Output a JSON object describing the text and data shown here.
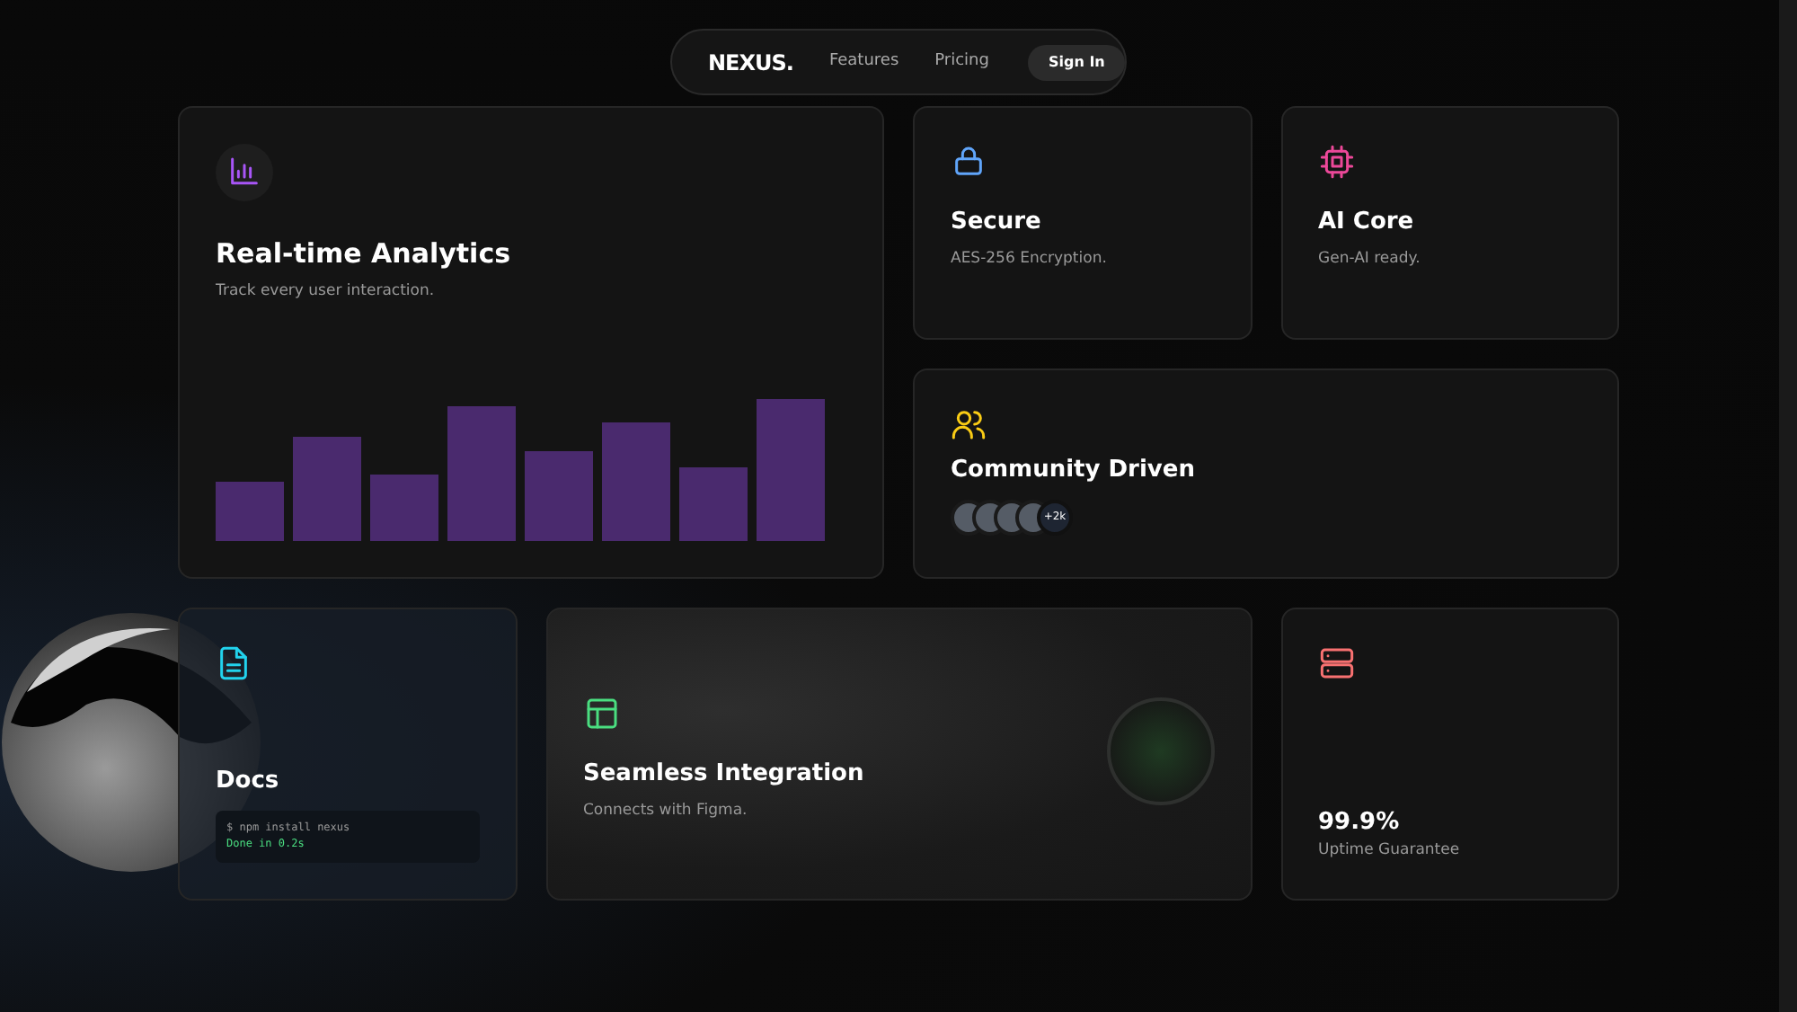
{
  "nav": {
    "logo": "NEXUS.",
    "links": [
      "Features",
      "Pricing"
    ],
    "button": "Sign In"
  },
  "cards": [
    {
      "kind": "analytics",
      "title": "Real-time Analytics",
      "text": "Track every user interaction.",
      "color": "#a855f7"
    },
    {
      "kind": "secure",
      "title": "Secure",
      "text": "AES-256 Encryption.",
      "color": "#60a5fa"
    },
    {
      "kind": "ai",
      "title": "AI Core",
      "text": "Gen-AI ready.",
      "color": "#ec4899"
    },
    {
      "kind": "community",
      "title": "Community Driven",
      "avatars": [
        {
          "kind": "avatar"
        },
        {
          "kind": "avatar"
        },
        {
          "kind": "avatar"
        },
        {
          "kind": "avatar"
        }
      ],
      "more": "+2k",
      "color": "#facc15"
    },
    {
      "kind": "docs",
      "title": "Docs",
      "terminal": [
        "$ npm install nexus",
        "Done in 0.2s"
      ],
      "color": "#22d3ee"
    },
    {
      "kind": "integration",
      "title": "Seamless Integration",
      "text": "Connects with Figma.",
      "color": "#4ade80"
    },
    {
      "kind": "uptime",
      "title": "99.9%",
      "text": "Uptime Guarantee",
      "color": "#f87171"
    }
  ]
}
